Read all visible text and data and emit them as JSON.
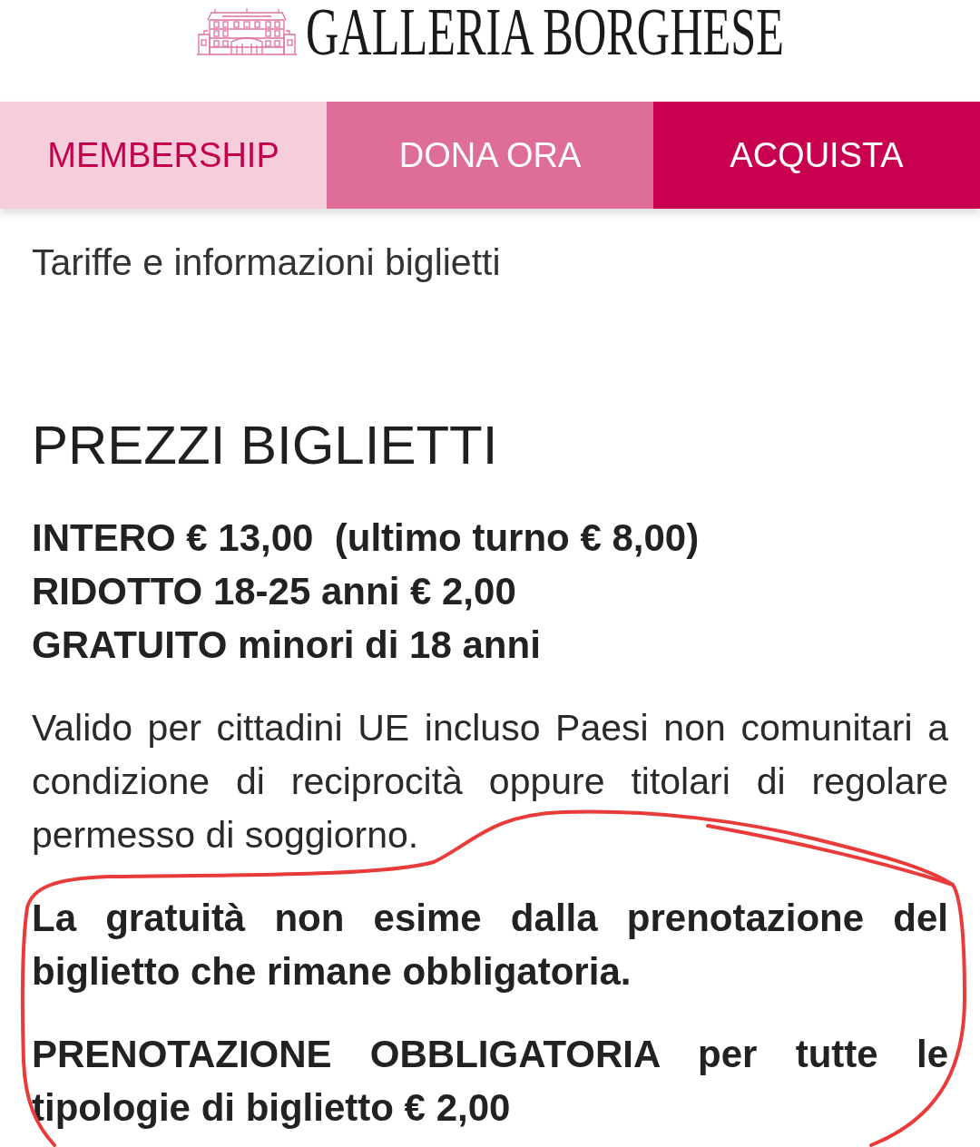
{
  "header": {
    "logo_text": "GALLERIA BORGHESE"
  },
  "nav": [
    {
      "label": "MEMBERSHIP",
      "kind": "soft"
    },
    {
      "label": "DONA ORA",
      "kind": "medium"
    },
    {
      "label": "ACQUISTA",
      "kind": "strong"
    }
  ],
  "breadcrumb": "Tariffe e informazioni biglietti",
  "section": {
    "title": "PREZZI BIGLIETTI",
    "prices": [
      "INTERO € 13,00  (ultimo turno € 8,00)",
      "RIDOTTO 18-25 anni € 2,00",
      "GRATUITO minori di 18 anni"
    ],
    "paragraphs": [
      {
        "kind": "normal",
        "text": "Valido per cittadini UE incluso Paesi non comunitari a condizione di reciprocità oppure titolari di regolare permesso di soggiorno."
      },
      {
        "kind": "bold",
        "text": "La gratuità non esime dalla prenotazione del biglietto che rimane obbligatoria."
      },
      {
        "kind": "bold",
        "text": "PRENOTAZIONE OBBLIGATORIA per tutte le tipologie di biglietto € 2,00"
      }
    ]
  }
}
